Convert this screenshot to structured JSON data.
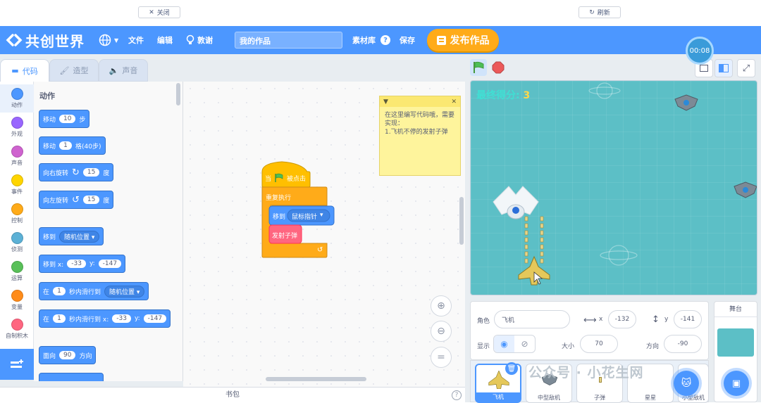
{
  "top_strip": {
    "close_label": "关闭",
    "refresh_label": "刷新"
  },
  "menubar": {
    "logo": "共创世界",
    "file": "文件",
    "edit": "编辑",
    "tips": "敦谢",
    "project_title": "我的作品",
    "assets": "素材库",
    "save": "保存",
    "publish": "发布作品"
  },
  "timer": "00:08",
  "tabs": {
    "code": "代码",
    "costumes": "造型",
    "sounds": "声音"
  },
  "categories": [
    {
      "label": "动作",
      "color": "#4c97ff"
    },
    {
      "label": "外观",
      "color": "#9966ff"
    },
    {
      "label": "声音",
      "color": "#cf63cf"
    },
    {
      "label": "事件",
      "color": "#ffd500"
    },
    {
      "label": "控制",
      "color": "#ffab19"
    },
    {
      "label": "侦测",
      "color": "#5cb1d6"
    },
    {
      "label": "运算",
      "color": "#59c059"
    },
    {
      "label": "变量",
      "color": "#ff8c1a"
    },
    {
      "label": "自制积木",
      "color": "#ff6680"
    }
  ],
  "palette": {
    "heading": "动作",
    "move": {
      "a": "移动",
      "v": "10",
      "b": "步"
    },
    "move_grid": {
      "a": "移动",
      "v": "1",
      "b": "格(40步)"
    },
    "turn_right": {
      "a": "向右旋转",
      "v": "15",
      "b": "度"
    },
    "turn_left": {
      "a": "向左旋转",
      "v": "15",
      "b": "度"
    },
    "goto": {
      "a": "移到",
      "dd": "随机位置"
    },
    "goto_xy": {
      "a": "移到 x:",
      "x": "-33",
      "b": "y:",
      "y": "-147"
    },
    "glide": {
      "a": "在",
      "v": "1",
      "b": "秒内滑行到",
      "dd": "随机位置"
    },
    "glide_xy": {
      "a": "在",
      "v": "1",
      "b": "秒内滑行到 x:",
      "x": "-33",
      "c": "y:",
      "y": "-147"
    },
    "point": {
      "a": "面向",
      "v": "90",
      "b": "方向"
    }
  },
  "script": {
    "hat_when": "当",
    "hat_clicked": "被点击",
    "forever": "重复执行",
    "goto": "移到",
    "goto_target": "鼠标指针",
    "fire": "发射子弹"
  },
  "note": {
    "text": "在这里编写代码哦，需要实现：\n1.飞机不停的发射子弹"
  },
  "backpack": "书包",
  "stage": {
    "score_label": "最终得分:",
    "score_value": "3"
  },
  "sprite_info": {
    "sprite_label": "角色",
    "sprite_name": "飞机",
    "x_label": "x",
    "x": "-132",
    "y_label": "y",
    "y": "-141",
    "show_label": "显示",
    "size_label": "大小",
    "size": "70",
    "direction_label": "方向",
    "direction": "-90"
  },
  "stage_panel": {
    "label": "舞台"
  },
  "sprites": [
    {
      "name": "飞机"
    },
    {
      "name": "中型敌机"
    },
    {
      "name": "子弹"
    },
    {
      "name": "星星"
    },
    {
      "name": "小型敌机"
    }
  ],
  "watermark": "公众号 · 小花生网",
  "colors": {
    "accent": "#4c97ff",
    "publish": "#ffab19",
    "control": "#ffab19",
    "events": "#ffbf00",
    "custom": "#ff6680",
    "stage_bg": "#5cbfc6"
  }
}
